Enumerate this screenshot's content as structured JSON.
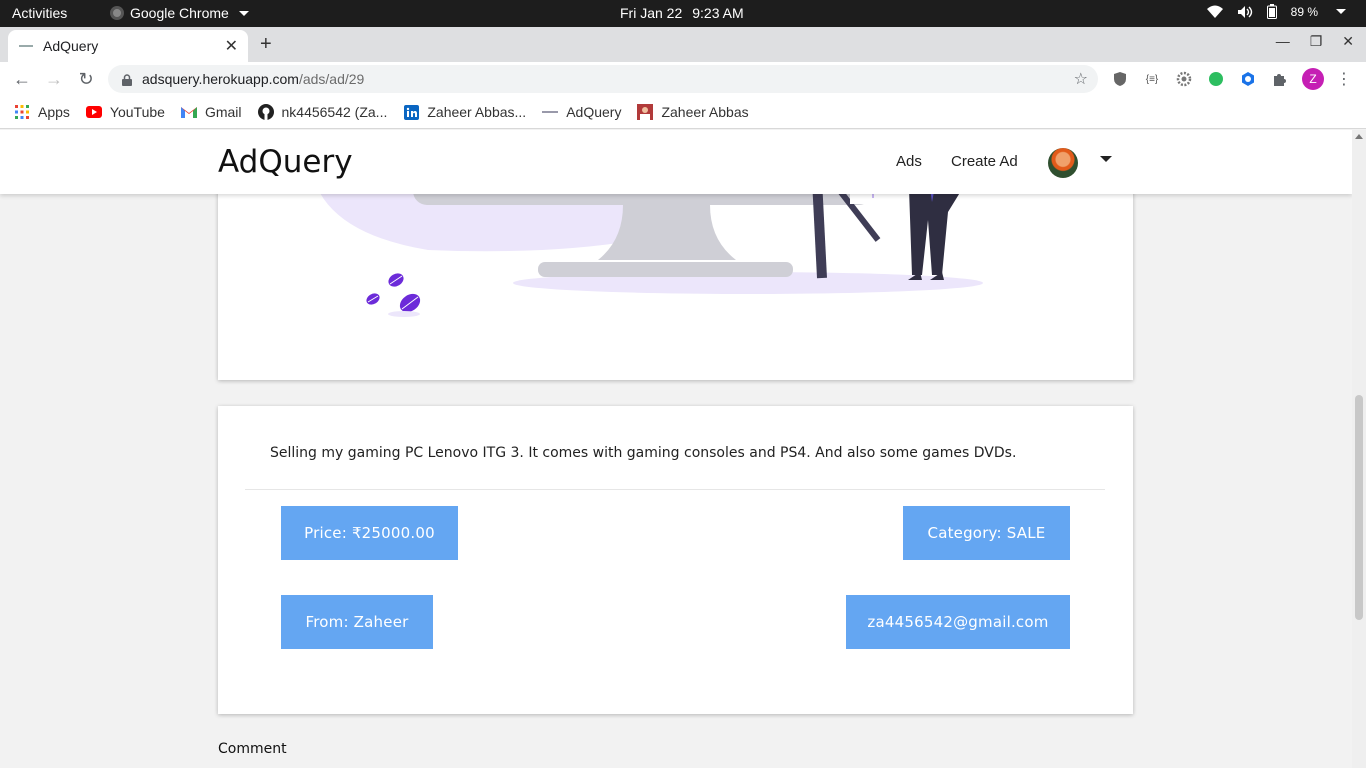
{
  "os_bar": {
    "activities": "Activities",
    "app_name": "Google Chrome",
    "date": "Fri Jan 22",
    "time": "9:23 AM",
    "battery": "89 %"
  },
  "browser": {
    "tab_title": "AdQuery",
    "tab_close": "✕",
    "new_tab": "+",
    "window_controls": {
      "minimize": "—",
      "restore": "❐",
      "close": "✕"
    },
    "url_host": "adsquery.herokuapp.com",
    "url_path": "/ads/ad/29",
    "profile_initial": "Z",
    "bookmarks": [
      {
        "label": "Apps",
        "icon": "apps-grid-icon"
      },
      {
        "label": "YouTube",
        "icon": "youtube-icon"
      },
      {
        "label": "Gmail",
        "icon": "gmail-icon"
      },
      {
        "label": "nk4456542 (Za...",
        "icon": "github-icon"
      },
      {
        "label": "Zaheer Abbas...",
        "icon": "linkedin-icon"
      },
      {
        "label": "AdQuery",
        "icon": "adquery-icon"
      },
      {
        "label": "Zaheer Abbas",
        "icon": "profile-photo-icon"
      }
    ]
  },
  "site": {
    "brand": "AdQuery",
    "nav_ads": "Ads",
    "nav_create": "Create Ad",
    "description": "Selling my gaming PC Lenovo ITG 3. It comes with gaming consoles and PS4. And also some games DVDs.",
    "price": "Price: ₹25000.00",
    "category": "Category: SALE",
    "from": "From: Zaheer",
    "email": "za4456542@gmail.com",
    "comment_label": "Comment"
  },
  "colors": {
    "accent": "#64a6f2",
    "illustration_purple": "#6c2bd9",
    "illustration_lavender": "#ece6fb"
  }
}
